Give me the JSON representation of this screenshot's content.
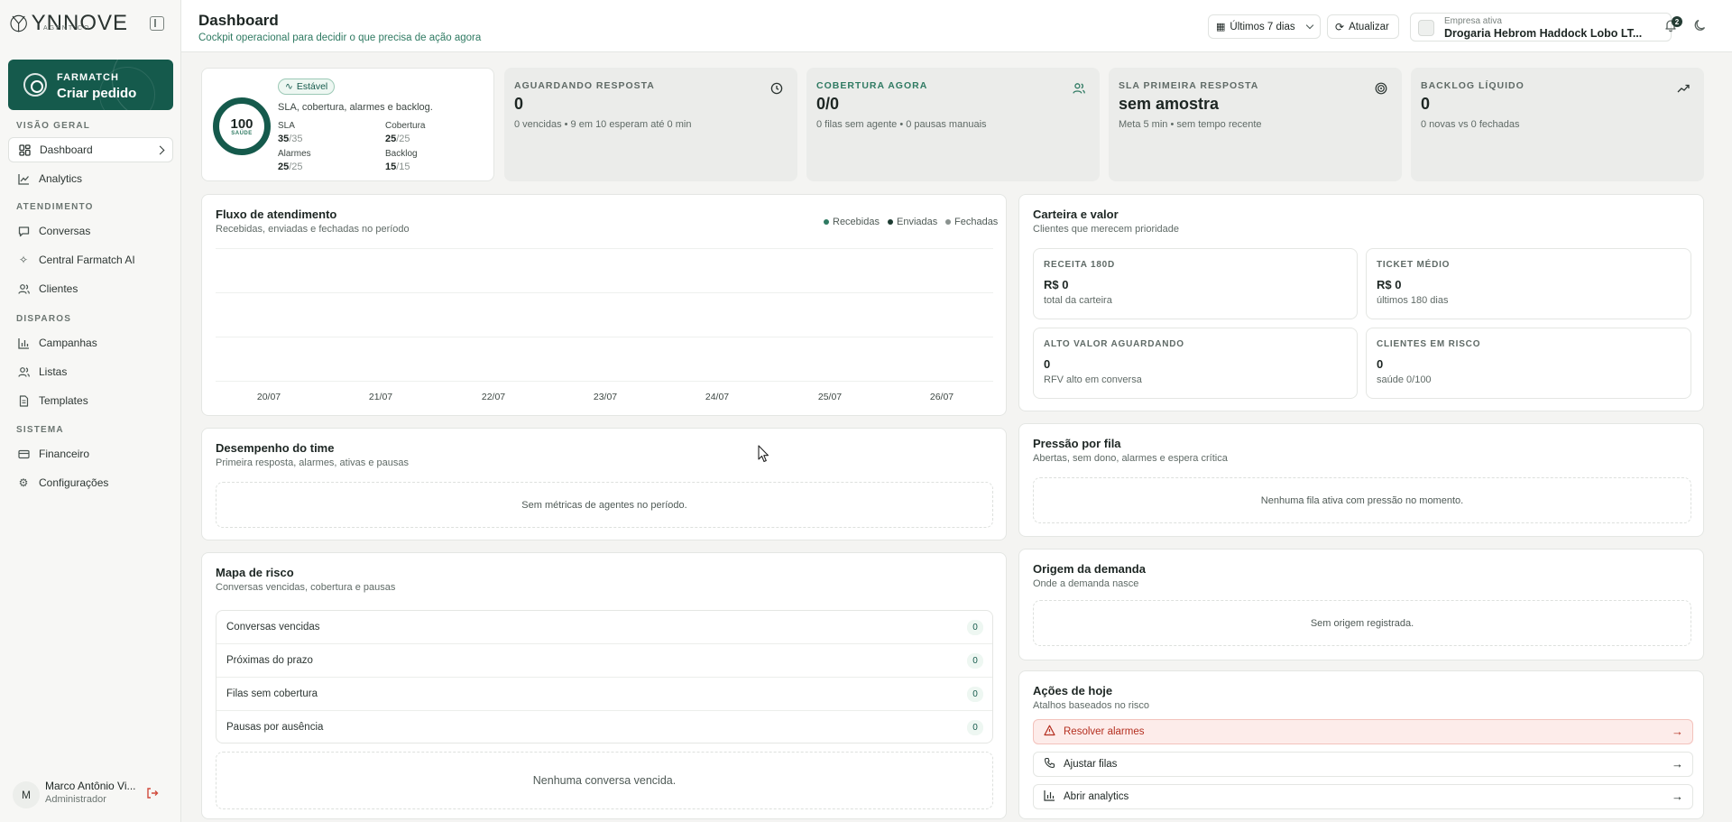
{
  "brand": {
    "logo_text": "YNNOVE",
    "logo_sub": "AGENT CO"
  },
  "sidebar": {
    "cta_small": "FARMATCH",
    "cta_big": "Criar pedido",
    "sections": [
      {
        "title": "VISÃO GERAL",
        "items": [
          {
            "label": "Dashboard",
            "icon": "grid-icon",
            "active": true
          },
          {
            "label": "Analytics",
            "icon": "chart-line-icon"
          }
        ]
      },
      {
        "title": "ATENDIMENTO",
        "items": [
          {
            "label": "Conversas",
            "icon": "chat-icon"
          },
          {
            "label": "Central Farmatch AI",
            "icon": "sparkles-icon"
          },
          {
            "label": "Clientes",
            "icon": "users-icon"
          }
        ]
      },
      {
        "title": "DISPAROS",
        "items": [
          {
            "label": "Campanhas",
            "icon": "bar-chart-icon"
          },
          {
            "label": "Listas",
            "icon": "users-icon"
          },
          {
            "label": "Templates",
            "icon": "file-icon"
          }
        ]
      },
      {
        "title": "SISTEMA",
        "items": [
          {
            "label": "Financeiro",
            "icon": "card-icon"
          },
          {
            "label": "Configurações",
            "icon": "gear-icon"
          }
        ]
      }
    ],
    "user": {
      "initial": "M",
      "name": "Marco Antônio Vi...",
      "role": "Administrador"
    }
  },
  "header": {
    "title": "Dashboard",
    "subtitle": "Cockpit operacional para decidir o que precisa de ação agora",
    "period": "Últimos 7 dias",
    "refresh": "Atualizar",
    "company_label": "Empresa ativa",
    "company_name": "Drogaria Hebrom Haddock Lobo LT...",
    "notifications": "2"
  },
  "health": {
    "score": "100",
    "score_label": "SAÚDE",
    "badge": "Estável",
    "summary": "SLA, cobertura, alarmes e backlog.",
    "stats": [
      {
        "label": "SLA",
        "value": "35",
        "total": "/35"
      },
      {
        "label": "Cobertura",
        "value": "25",
        "total": "/25"
      },
      {
        "label": "Alarmes",
        "value": "25",
        "total": "/25"
      },
      {
        "label": "Backlog",
        "value": "15",
        "total": "/15"
      }
    ]
  },
  "kpis": [
    {
      "label": "AGUARDANDO RESPOSTA",
      "value": "0",
      "sub": "0 vencidas • 9 em 10 esperam até 0 min",
      "icon": "clock-icon",
      "accent": "#5f6a66"
    },
    {
      "label": "COBERTURA AGORA",
      "value": "0/0",
      "sub": "0 filas sem agente • 0 pausas manuais",
      "icon": "users-icon",
      "accent": "#2f7a62"
    },
    {
      "label": "SLA PRIMEIRA RESPOSTA",
      "value": "sem amostra",
      "sub": "Meta 5 min • sem tempo recente",
      "icon": "target-icon",
      "accent": "#5f6a66"
    },
    {
      "label": "BACKLOG LÍQUIDO",
      "value": "0",
      "sub": "0 novas vs 0 fechadas",
      "icon": "trend-icon",
      "accent": "#5f6a66"
    }
  ],
  "flow": {
    "title": "Fluxo de atendimento",
    "subtitle": "Recebidas, enviadas e fechadas no período",
    "legend": [
      {
        "name": "Recebidas",
        "color": "#2f7a62"
      },
      {
        "name": "Enviadas",
        "color": "#1d3b32"
      },
      {
        "name": "Fechadas",
        "color": "#8a928f"
      }
    ],
    "ticks": [
      "20/07",
      "21/07",
      "22/07",
      "23/07",
      "24/07",
      "25/07",
      "26/07"
    ]
  },
  "wallet": {
    "title": "Carteira e valor",
    "subtitle": "Clientes que merecem prioridade",
    "cells": [
      {
        "label": "RECEITA 180D",
        "value": "R$ 0",
        "sub": "total da carteira"
      },
      {
        "label": "TICKET MÉDIO",
        "value": "R$ 0",
        "sub": "últimos 180 dias"
      },
      {
        "label": "ALTO VALOR AGUARDANDO",
        "value": "0",
        "sub": "RFV alto em conversa"
      },
      {
        "label": "CLIENTES EM RISCO",
        "value": "0",
        "sub": "saúde 0/100"
      }
    ]
  },
  "team": {
    "title": "Desempenho do time",
    "subtitle": "Primeira resposta, alarmes, ativas e pausas",
    "empty": "Sem métricas de agentes no período."
  },
  "queue": {
    "title": "Pressão por fila",
    "subtitle": "Abertas, sem dono, alarmes e espera crítica",
    "empty": "Nenhuma fila ativa com pressão no momento."
  },
  "risk": {
    "title": "Mapa de risco",
    "subtitle": "Conversas vencidas, cobertura e pausas",
    "rows": [
      {
        "label": "Conversas vencidas",
        "count": "0"
      },
      {
        "label": "Próximas do prazo",
        "count": "0"
      },
      {
        "label": "Filas sem cobertura",
        "count": "0"
      },
      {
        "label": "Pausas por ausência",
        "count": "0"
      }
    ],
    "empty": "Nenhuma conversa vencida."
  },
  "origin": {
    "title": "Origem da demanda",
    "subtitle": "Onde a demanda nasce",
    "empty": "Sem origem registrada."
  },
  "actions": {
    "title": "Ações de hoje",
    "subtitle": "Atalhos baseados no risco",
    "items": [
      {
        "label": "Resolver alarmes",
        "icon": "warning-icon"
      },
      {
        "label": "Ajustar filas",
        "icon": "phone-icon"
      },
      {
        "label": "Abrir analytics",
        "icon": "bar-chart-icon"
      }
    ]
  }
}
